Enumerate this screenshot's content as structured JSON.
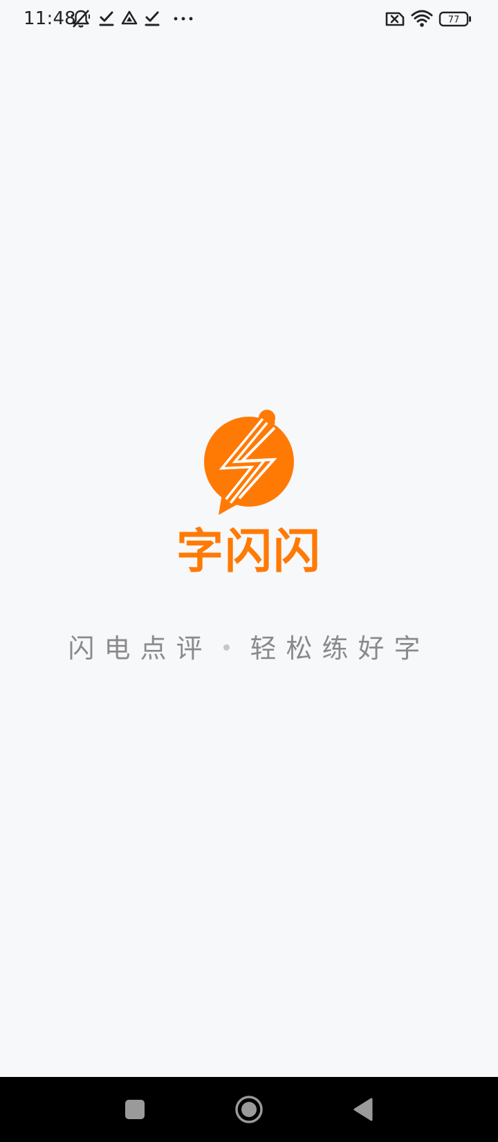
{
  "status_bar": {
    "time": "11:48",
    "notification_icons": [
      "mute-bell-icon",
      "check-icon",
      "drive-icon",
      "check-icon",
      "more-dots-icon"
    ],
    "system_icons": [
      "no-sim-icon",
      "wifi-icon",
      "battery-icon"
    ],
    "battery_level": "77"
  },
  "splash": {
    "app_name": "字闪闪",
    "slogan_left": "闪电点评",
    "slogan_right": "轻松练好字",
    "brand_color": "#ff7a05"
  },
  "nav_bar": {
    "buttons": [
      "recents-button",
      "home-button",
      "back-button"
    ]
  }
}
